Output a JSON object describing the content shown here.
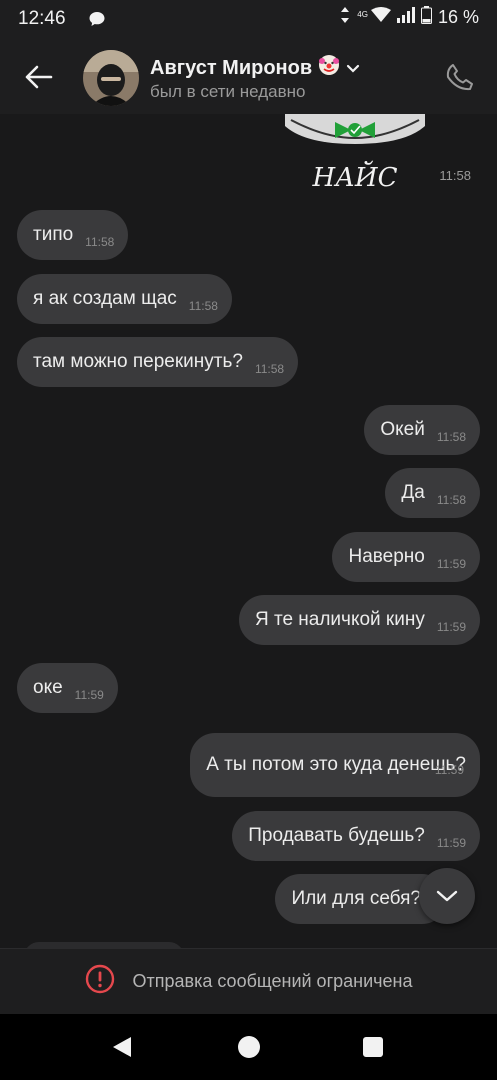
{
  "status_bar": {
    "time": "12:46",
    "network": "4G",
    "battery": "16 %"
  },
  "header": {
    "contact_name": "Август Миронов",
    "contact_status": "был в сети недавно",
    "icons": [
      "back-arrow-icon",
      "clown-emoji-icon",
      "chevron-down-icon",
      "phone-icon"
    ]
  },
  "chat": {
    "sticker": {
      "caption": "НАЙС",
      "time": "11:58"
    },
    "messages": [
      {
        "direction": "in",
        "text": "типо",
        "time": "11:58"
      },
      {
        "direction": "in",
        "text": "я ак создам щас",
        "time": "11:58"
      },
      {
        "direction": "in",
        "text": "там можно перекинуть?",
        "time": "11:58"
      },
      {
        "direction": "out",
        "text": "Окей",
        "time": "11:58"
      },
      {
        "direction": "out",
        "text": "Да",
        "time": "11:58"
      },
      {
        "direction": "out",
        "text": "Наверно",
        "time": "11:59"
      },
      {
        "direction": "out",
        "text": "Я те наличкой кину",
        "time": "11:59"
      },
      {
        "direction": "in",
        "text": "оке",
        "time": "11:59"
      },
      {
        "direction": "out",
        "text": "А ты потом это куда денешь?",
        "time": "11:59"
      },
      {
        "direction": "out",
        "text": "Продавать будешь?",
        "time": "11:59"
      },
      {
        "direction": "out",
        "text": "Или для себя?",
        "time": ""
      }
    ]
  },
  "restricted": {
    "text": "Отправка сообщений ограничена",
    "accent_color": "#e5484d"
  }
}
